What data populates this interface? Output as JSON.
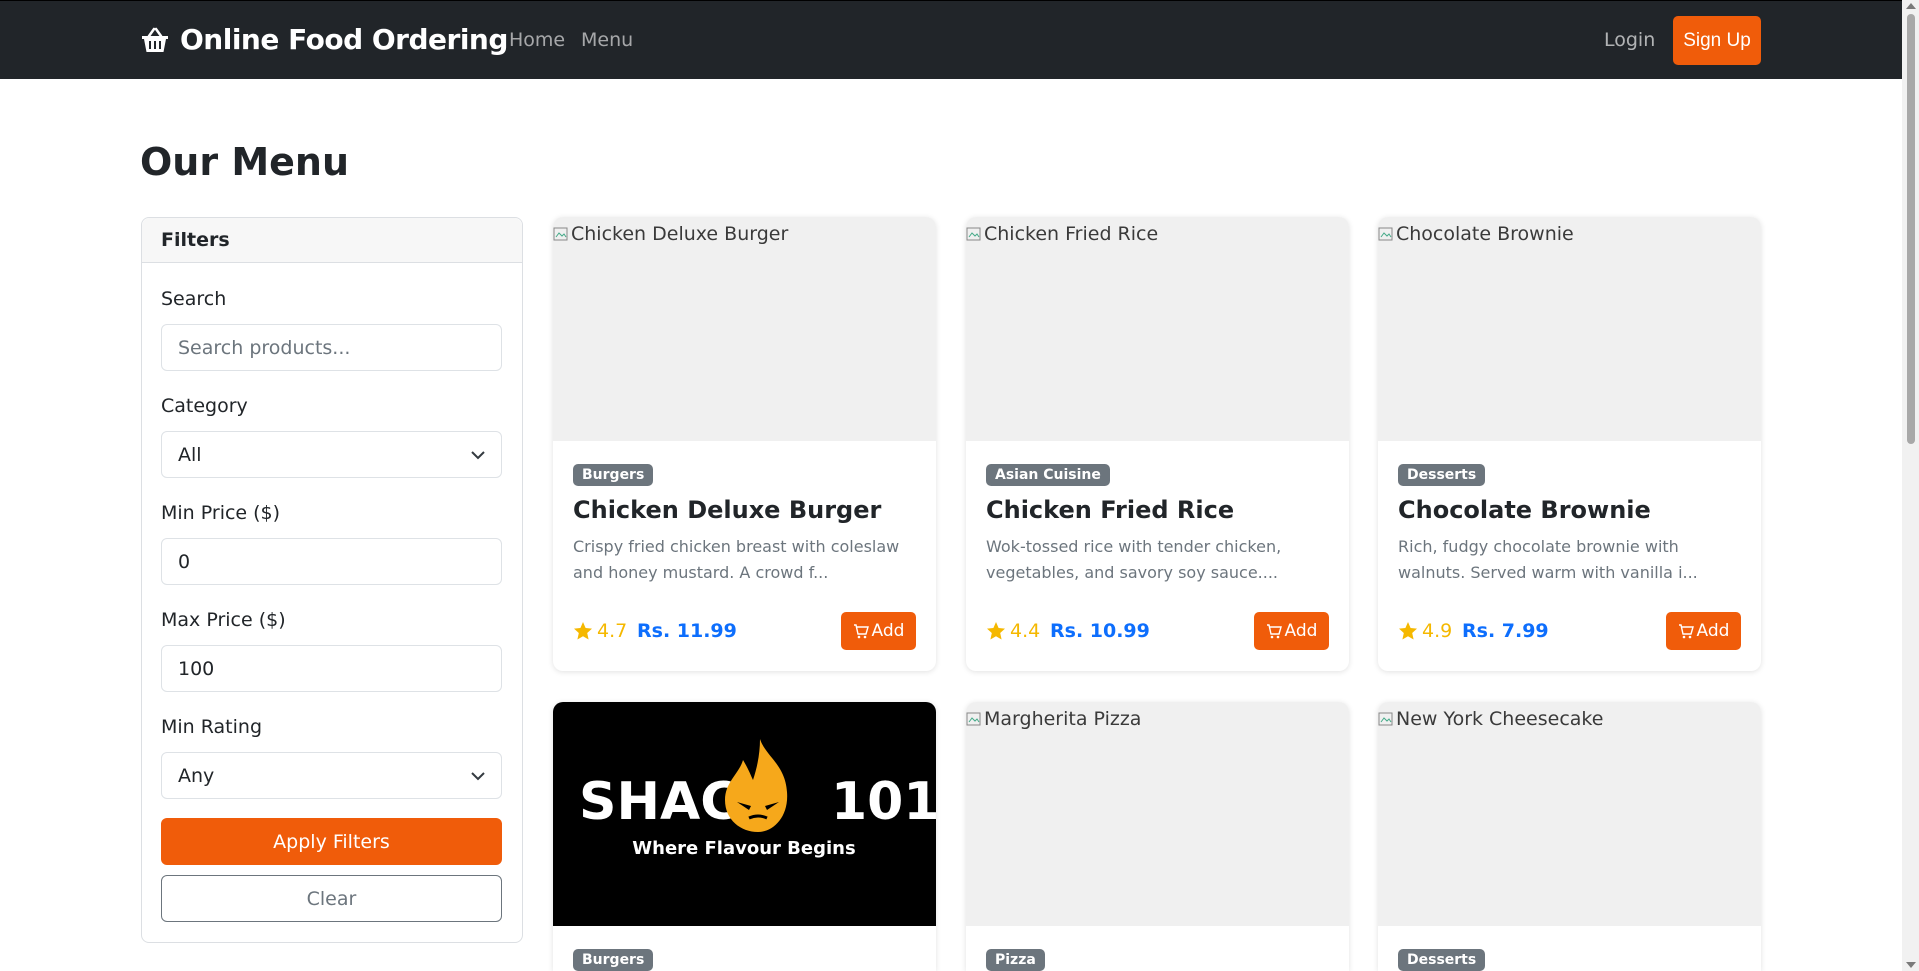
{
  "navbar": {
    "brand": "Online Food Ordering",
    "links": [
      "Home",
      "Menu"
    ],
    "login": "Login",
    "signup": "Sign Up"
  },
  "page_title": "Our Menu",
  "filters": {
    "header": "Filters",
    "search_label": "Search",
    "search_placeholder": "Search products...",
    "category_label": "Category",
    "category_value": "All",
    "min_price_label": "Min Price ($)",
    "min_price_value": "0",
    "max_price_label": "Max Price ($)",
    "max_price_value": "100",
    "min_rating_label": "Min Rating",
    "min_rating_value": "Any",
    "apply": "Apply Filters",
    "clear": "Clear"
  },
  "products": [
    {
      "name": "Chicken Deluxe Burger",
      "alt": "Chicken Deluxe Burger",
      "category": "Burgers",
      "desc": "Crispy fried chicken breast with coleslaw and honey mustard. A crowd f...",
      "rating": "4.7",
      "price": "Rs. 11.99",
      "add": "Add"
    },
    {
      "name": "Chicken Fried Rice",
      "alt": "Chicken Fried Rice",
      "category": "Asian Cuisine",
      "desc": "Wok-tossed rice with tender chicken, vegetables, and savory soy sauce....",
      "rating": "4.4",
      "price": "Rs. 10.99",
      "add": "Add"
    },
    {
      "name": "Chocolate Brownie",
      "alt": "Chocolate Brownie",
      "category": "Desserts",
      "desc": "Rich, fudgy chocolate brownie with walnuts. Served warm with vanilla i...",
      "rating": "4.9",
      "price": "Rs. 7.99",
      "add": "Add"
    }
  ],
  "products_row2": [
    {
      "category": "Burgers",
      "logo_text_left": "SHACK",
      "logo_text_right": "101",
      "logo_tagline": "Where Flavour Begins"
    },
    {
      "category": "Pizza",
      "alt": "Margherita Pizza"
    },
    {
      "category": "Desserts",
      "alt": "New York Cheesecake"
    }
  ],
  "colors": {
    "navbar": "#212529",
    "accent": "#f05c0a",
    "price": "#0d6efd",
    "star": "#f5b800",
    "badge": "#6c757d"
  }
}
